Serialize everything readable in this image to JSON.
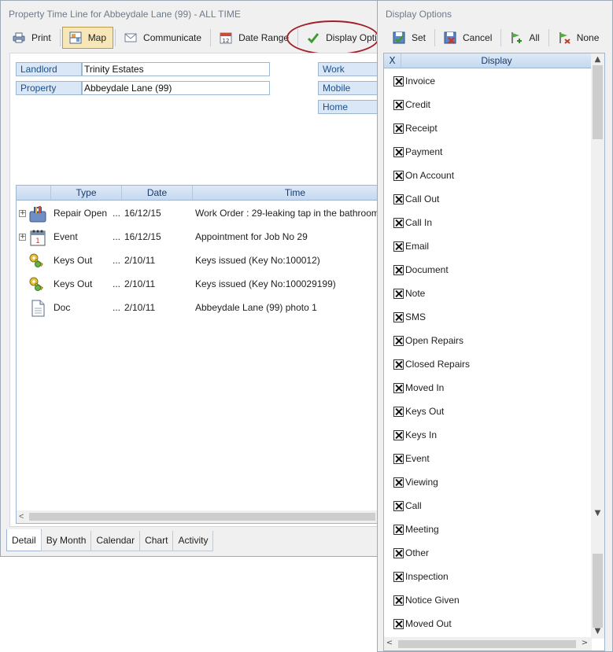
{
  "main_window": {
    "title": "Property Time Line for Abbeydale Lane (99) - ALL TIME",
    "toolbar": {
      "print": "Print",
      "map": "Map",
      "communicate": "Communicate",
      "date_range": "Date Range",
      "display_options": "Display Options"
    },
    "fields": {
      "landlord_label": "Landlord",
      "landlord_value": "Trinity Estates",
      "property_label": "Property",
      "property_value": "Abbeydale Lane (99)",
      "work_label": "Work",
      "mobile_label": "Mobile",
      "home_label": "Home"
    },
    "grid": {
      "columns": [
        "Type",
        "Date",
        "Time"
      ],
      "rows": [
        {
          "icon": "toolbox-icon",
          "expandable": true,
          "type": "Repair Open",
          "date": "16/12/15",
          "description": "Work Order : 29-leaking tap in the bathroom"
        },
        {
          "icon": "calendar-icon",
          "expandable": true,
          "type": "Event",
          "date": "16/12/15",
          "description": "Appointment for Job No 29"
        },
        {
          "icon": "keys-icon",
          "expandable": false,
          "type": "Keys Out",
          "date": "2/10/11",
          "description": "Keys issued (Key No:100012)"
        },
        {
          "icon": "keys-icon",
          "expandable": false,
          "type": "Keys Out",
          "date": "2/10/11",
          "description": "Keys issued (Key No:100029199)"
        },
        {
          "icon": "document-icon",
          "expandable": false,
          "type": "Doc",
          "date": "2/10/11",
          "description": "Abbeydale Lane (99) photo 1"
        }
      ]
    },
    "tabs": [
      "Detail",
      "By Month",
      "Calendar",
      "Chart",
      "Activity"
    ],
    "active_tab": "Detail"
  },
  "options_window": {
    "title": "Display Options",
    "toolbar": {
      "set": "Set",
      "cancel": "Cancel",
      "all": "All",
      "none": "None"
    },
    "header_x": "X",
    "header_label": "Display",
    "items": [
      "Invoice",
      "Credit",
      "Receipt",
      "Payment",
      "On Account",
      "Call Out",
      "Call In",
      "Email",
      "Document",
      "Note",
      "SMS",
      "Open Repairs",
      "Closed Repairs",
      "Moved In",
      "Keys Out",
      "Keys In",
      "Event",
      "Viewing",
      "Call",
      "Meeting",
      "Other",
      "Inspection",
      "Notice Given",
      "Moved Out"
    ]
  },
  "colors": {
    "highlight_ring": "#a0202a",
    "label_blue": "#1b4f8a",
    "header_gradient_top": "#dde9f7"
  }
}
